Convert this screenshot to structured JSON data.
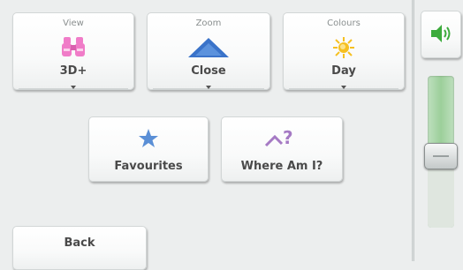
{
  "view": {
    "caption": "View",
    "value": "3D+"
  },
  "zoom": {
    "caption": "Zoom",
    "value": "Close"
  },
  "colours": {
    "caption": "Colours",
    "value": "Day"
  },
  "favourites": {
    "label": "Favourites"
  },
  "where_am_i": {
    "label": "Where Am I?"
  },
  "back": {
    "label": "Back"
  },
  "volume": {
    "level": 0.47
  },
  "colors": {
    "view_icon": "#f07cc8",
    "zoom_icon": "#3a73c9",
    "colours_icon": "#f6c020",
    "star_icon": "#5a8fd6",
    "where_icon": "#a57ac4",
    "speaker_green": "#3cab3c",
    "slider_green": "#9ccf9a"
  },
  "icons": {
    "view": "binoculars-icon",
    "zoom": "zoom-triangle-icon",
    "colours": "sun-icon",
    "favourites": "star-icon",
    "where_am_i": "where-am-i-icon",
    "volume": "speaker-icon"
  }
}
